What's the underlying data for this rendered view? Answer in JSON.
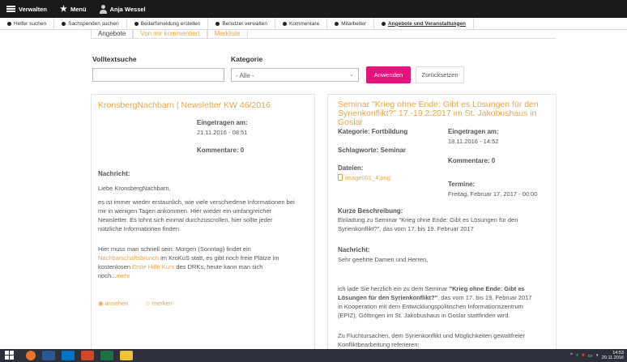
{
  "topbar": {
    "manage": "Verwalten",
    "menu": "Menü",
    "user": "Anja Wessel"
  },
  "subnav": [
    "Helfer suchen",
    "Sachspenden suchen",
    "Bedarfsmeldung erstellen",
    "Benutzer verwalten",
    "Kommentare",
    "Mitarbeiter",
    "Angebote und Veranstaltungen"
  ],
  "tabs": [
    "Angebote",
    "Von mir kommentiert",
    "Merkliste"
  ],
  "filter": {
    "fulltext_label": "Volltextsuche",
    "fulltext_value": "",
    "category_label": "Kategorie",
    "category_value": "- Alle -",
    "apply": "Anwenden",
    "reset": "Zurücksetzen"
  },
  "left_card": {
    "title": "KronsbergNachbarn | Newsletter KW 46/2016",
    "entered_label": "Eingetragen am:",
    "entered_value": "21.11.2016 - 08:51",
    "comments": "Kommentare: 0",
    "message_label": "Nachricht:",
    "p1": "Liebe KronsbergNachbarn,",
    "p2a": "es ist immer wieder erstaunlich, wie viele verschiedene Informationen bei",
    "p2b": "mir in wenigen Tagen ankommen. Hier wieder ein umfangreicher",
    "p2c": "Newsletter. Es lohnt sich einmal durchzuscrollen, hier sollte jeder",
    "p2d": "nützliche Informationen finden.",
    "p3a": "Hier muss man schnell sein: Morgen (Sonntag) findet ein",
    "p3b_link": "Nachbarschaftsbrunch",
    "p3b": " im KroKuS statt, es gibt noch freie Plätze im",
    "p3c": "kostenlosen ",
    "p3c_link": "Erste Hilfe Kurs",
    "p3c_rest": " des DRKs, heute kann man sich",
    "p3d": "noch...",
    "more": "mehr",
    "view": "ansehen",
    "remember": "merken"
  },
  "right_card": {
    "title1": "Seminar \"Krieg ohne Ende: Gibt es Lösungen für den",
    "title2": "Syrienkonflikt?\" 17.-19.2.2017 im St. Jakobushaus in Goslar",
    "category": "Kategorie: Fortbildung",
    "keywords": "Schlagworte: Seminar",
    "entered_label": "Eingetragen am:",
    "entered_value": "18.11.2016 - 14:52",
    "comments": "Kommentare: 0",
    "files_label": "Dateien:",
    "file": "image001_4.png",
    "dates_label": "Termine:",
    "dates_value": "Freitag, Februar 17, 2017 - 00:00",
    "short_label": "Kurze Beschreibung:",
    "short1": "Einladung zu Seminar \"Krieg ohne Ende: Gibt es Lösungen für den",
    "short2": "Syrienkonflikt?\", das vom 17. bis 19. Februar 2017",
    "message_label": "Nachricht:",
    "m1": "Sehr geehrte Damen und Herren,",
    "m2a": "ich lade Sie herzlich ein zu dem Seminar ",
    "m2a_bold": "\"Krieg ohne Ende: Gibt es",
    "m2b_bold": "Lösungen für den Syrienkonflikt?\"",
    "m2b": ", das vom 17. bis 19. Februar 2017",
    "m2c": "in Kooperation mit dem Entwicklungspolitischen Informationszentrum",
    "m2d": "(EPIZ), Göttingen im St. Jakobushaus in Goslar stattfinden wird.",
    "m3a": "Zu Fluchtursachen, dem Syrienkonflikt und Möglichkeiten gewaltfreier",
    "m3b": "Konfliktbearbeitung referieren:"
  },
  "taskbar": {
    "time": "14:53",
    "date": "20.11.2016"
  }
}
